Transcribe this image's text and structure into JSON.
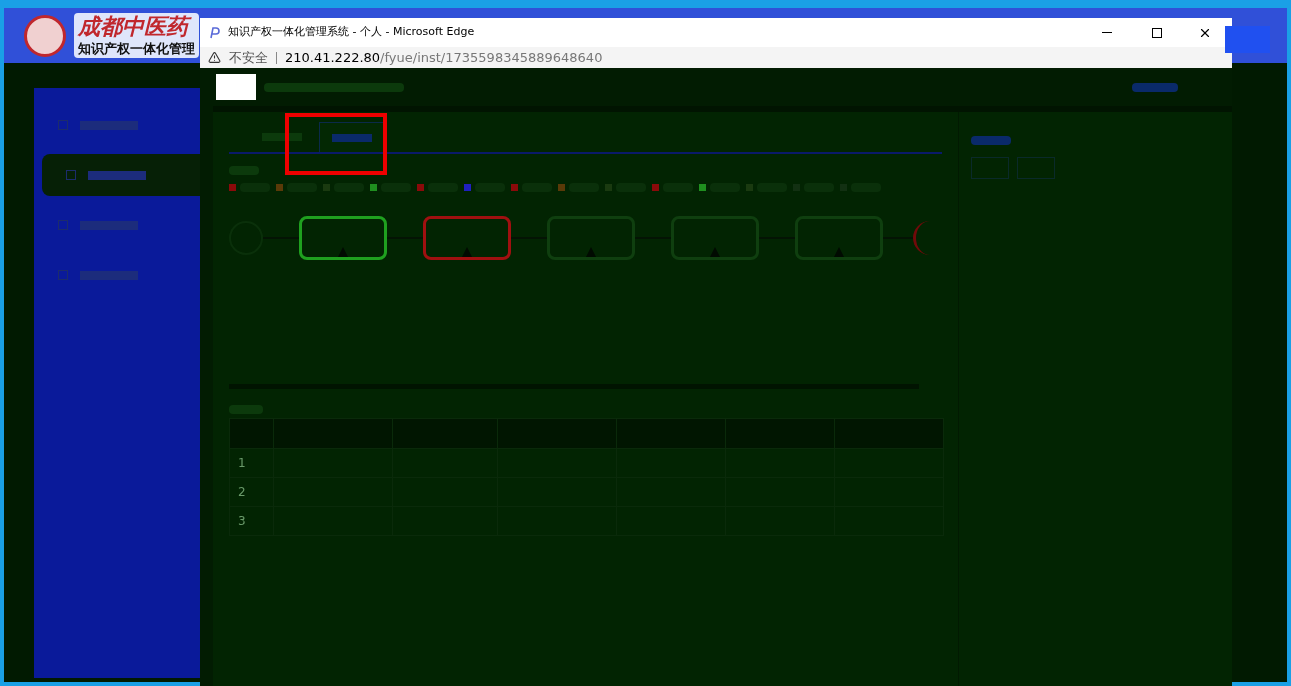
{
  "background_app": {
    "logo_title": "成都中医药",
    "subtitle": "知识产权一体化管理"
  },
  "browser": {
    "title": "知识产权一体化管理系统 - 个人 - Microsoft Edge",
    "security": "不安全",
    "url_host": "210.41.222.80",
    "url_path": "/fyue/inst/1735598345889648640"
  },
  "sidebar": {
    "items": [
      {
        "selected": false
      },
      {
        "selected": true
      },
      {
        "selected": false
      },
      {
        "selected": false
      }
    ]
  },
  "tabs": [
    {
      "selected": false
    },
    {
      "selected": true
    }
  ],
  "legend": [
    {
      "color": "#8b0a0a"
    },
    {
      "color": "#5a3a08"
    },
    {
      "color": "#1a3a10"
    },
    {
      "color": "#1f8f1f"
    },
    {
      "color": "#8b0a0a"
    },
    {
      "color": "#2020c0"
    },
    {
      "color": "#8b0a0a"
    },
    {
      "color": "#5a3a08"
    },
    {
      "color": "#1a3a10"
    },
    {
      "color": "#8b0a0a"
    },
    {
      "color": "#1f8f1f"
    },
    {
      "color": "#1a3a10"
    },
    {
      "color": "#123012"
    },
    {
      "color": "#123012"
    }
  ],
  "flow_nodes": [
    {
      "color": "#1fa01f"
    },
    {
      "color": "#a01010"
    },
    {
      "color": "#0f3f0f"
    },
    {
      "color": "#0f3f0f"
    },
    {
      "color": "#0f3f0f"
    }
  ],
  "table": {
    "rows": [
      {
        "index": "1"
      },
      {
        "index": "2"
      },
      {
        "index": "3"
      }
    ]
  }
}
